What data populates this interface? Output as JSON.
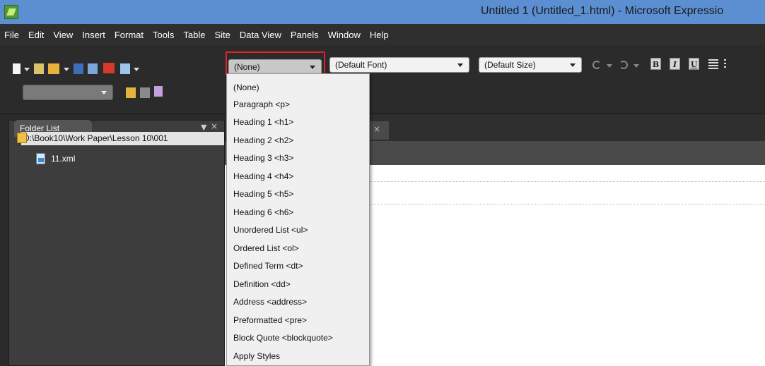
{
  "window": {
    "title": "Untitled 1 (Untitled_1.html) - Microsoft Expressio"
  },
  "menubar": {
    "items": [
      "File",
      "Edit",
      "View",
      "Insert",
      "Format",
      "Tools",
      "Table",
      "Site",
      "Data View",
      "Panels",
      "Window",
      "Help"
    ]
  },
  "toolbar": {
    "style_value": "(None)",
    "font_value": "(Default Font)",
    "size_value": "(Default Size)",
    "bold_label": "B",
    "italic_label": "I",
    "underline_label": "U"
  },
  "folder_panel": {
    "title": "Folder List",
    "root_path": "D:\\Book10\\Work Paper\\Lesson 10\\001",
    "files": [
      "11.xml"
    ]
  },
  "style_dropdown": {
    "options": [
      "(None)",
      "Paragraph <p>",
      "Heading 1 <h1>",
      "Heading 2 <h2>",
      "Heading 3 <h3>",
      "Heading 4 <h4>",
      "Heading 5 <h5>",
      "Heading 6 <h6>",
      "Unordered List <ul>",
      "Ordered List <ol>",
      "Defined Term <dt>",
      "Definition <dd>",
      "Address <address>",
      "Preformatted <pre>",
      "Block Quote <blockquote>",
      "Apply Styles"
    ]
  },
  "colors": {
    "titlebar": "#5b8fd1",
    "highlight_outline": "#e0212a"
  },
  "icons": [
    "app-icon",
    "new-page-icon",
    "open-icon",
    "save-icon",
    "publish-icon",
    "preview-icon",
    "undo-icon",
    "redo-icon",
    "pin-icon",
    "close-icon",
    "folder-icon",
    "xml-file-icon"
  ]
}
